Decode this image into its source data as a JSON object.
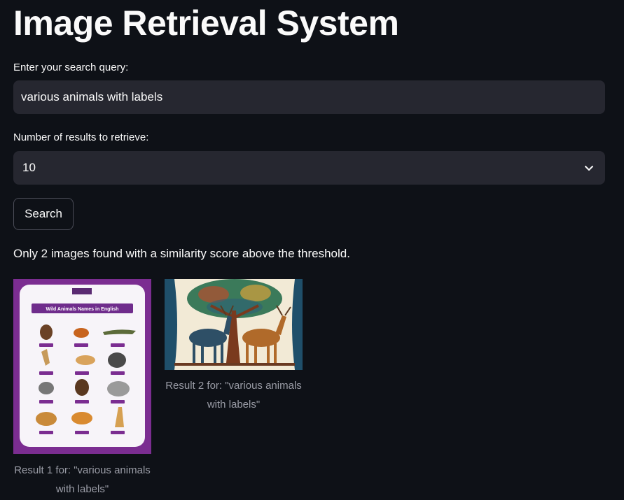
{
  "app": {
    "title": "Image Retrieval System"
  },
  "query": {
    "label": "Enter your search query:",
    "value": "various animals with labels"
  },
  "count": {
    "label": "Number of results to retrieve:",
    "value": "10"
  },
  "search_button": {
    "label": "Search"
  },
  "status": {
    "text": "Only 2 images found with a similarity score above the threshold."
  },
  "results": [
    {
      "caption": "Result 1 for: \"various animals with labels\"",
      "image_heading": "Wild Animals Names in English"
    },
    {
      "caption": "Result 2 for: \"various animals with labels\""
    }
  ],
  "icons": {
    "dropdown": "chevron-down-icon"
  },
  "colors": {
    "background": "#0e1117",
    "input": "#262730",
    "text": "#fafafa",
    "caption": "#9a9ca6",
    "poster_purple": "#7b2d91"
  }
}
